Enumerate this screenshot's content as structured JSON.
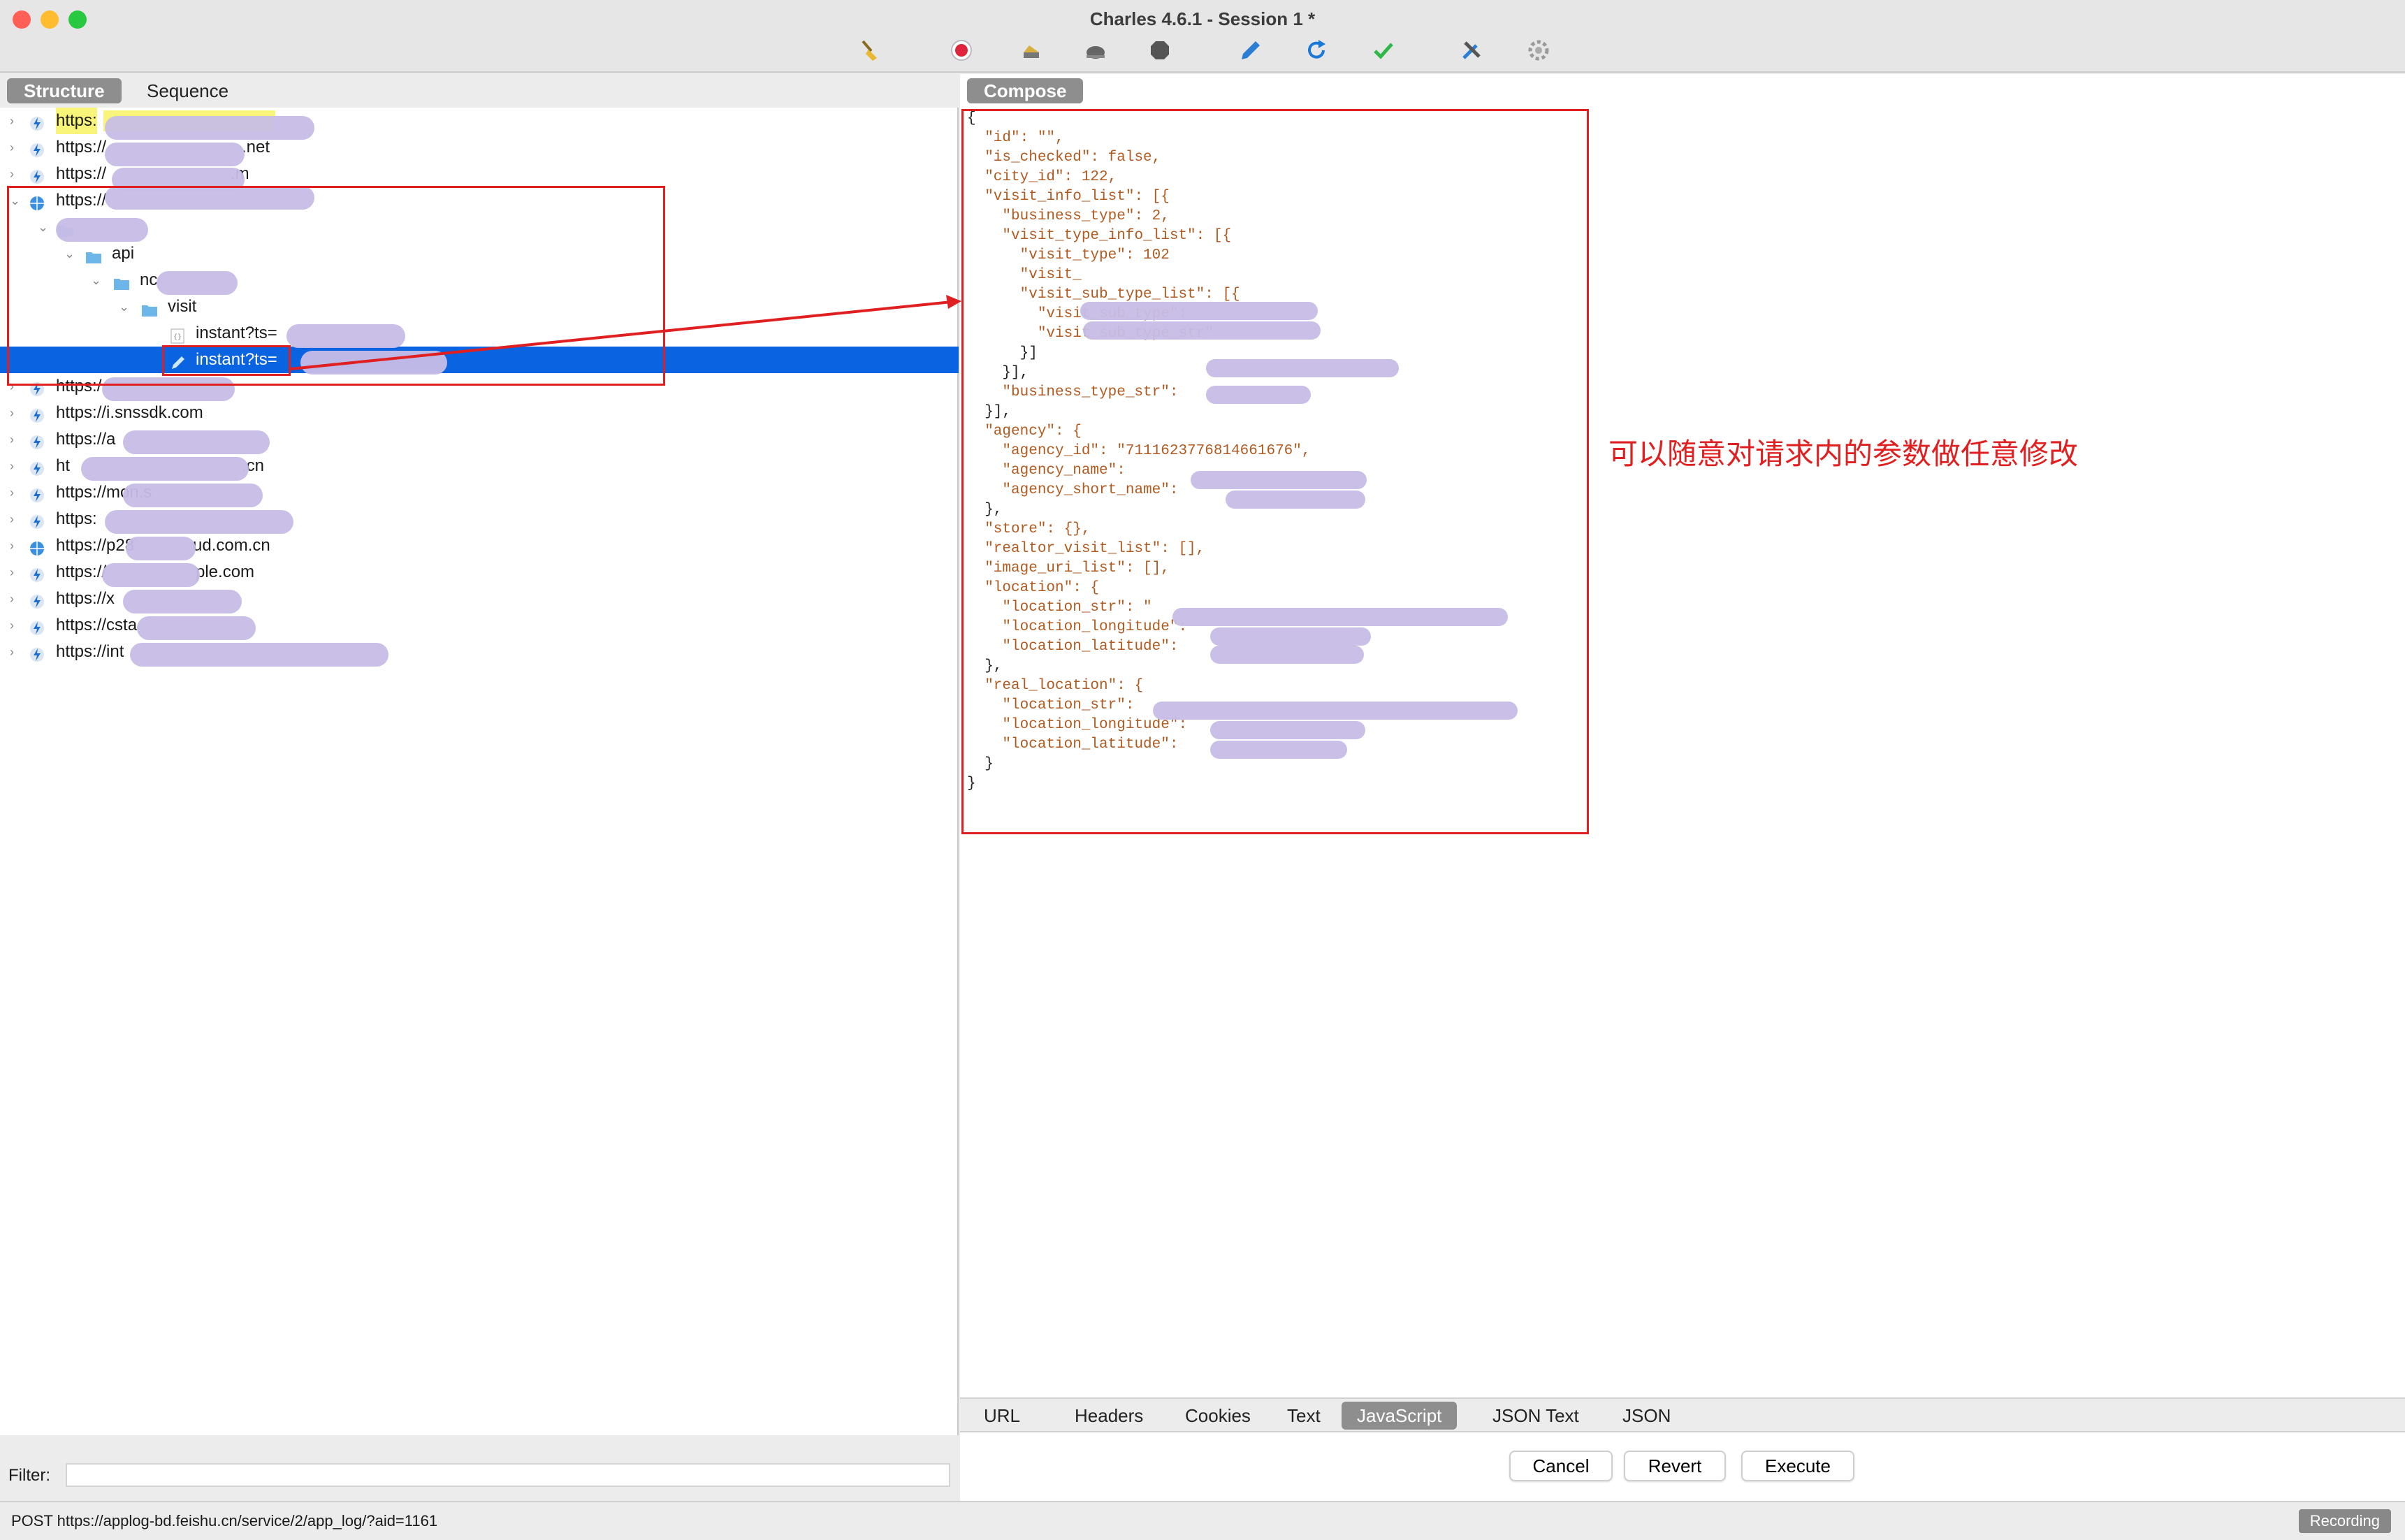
{
  "window": {
    "title": "Charles 4.6.1 - Session 1 *"
  },
  "toolbar": {
    "icons": [
      "broom-icon",
      "record-icon",
      "throttle-icon",
      "turtle-icon",
      "stop-icon",
      "pen-icon",
      "refresh-icon",
      "check-icon",
      "tools-icon",
      "settings-icon"
    ]
  },
  "left_tabs": {
    "structure": "Structure",
    "sequence": "Sequence"
  },
  "tree": {
    "rows": [
      {
        "label": "https:",
        "icon": "lightning-icon"
      },
      {
        "label": "https://",
        "suffix": ".net",
        "icon": "lightning-icon"
      },
      {
        "label": "https://",
        "suffix": ".m",
        "icon": "lightning-icon"
      },
      {
        "label": "https://",
        "icon": "globe-icon"
      },
      {
        "label": "",
        "icon": "folder-icon"
      },
      {
        "label": "api",
        "icon": "folder-icon"
      },
      {
        "label": "nc",
        "icon": "folder-icon"
      },
      {
        "label": "visit",
        "icon": "folder-icon"
      },
      {
        "label": "instant?ts=",
        "icon": "json-file-icon"
      },
      {
        "label": "instant?ts=",
        "icon": "edit-icon"
      },
      {
        "label": "https:/",
        "icon": "lightning-icon"
      },
      {
        "label": "https://i.snssdk.com",
        "icon": "lightning-icon"
      },
      {
        "label": "https://a",
        "icon": "lightning-icon"
      },
      {
        "label": "ht",
        "suffix": ".cn",
        "icon": "lightning-icon"
      },
      {
        "label": "https://mon.s",
        "icon": "lightning-icon"
      },
      {
        "label": "https:",
        "icon": "lightning-icon"
      },
      {
        "label": "https://p28",
        "suffix": "ud.com.cn",
        "icon": "globe-icon"
      },
      {
        "label": "https://",
        "suffix": "ple.com",
        "icon": "lightning-icon"
      },
      {
        "label": "https://x",
        "icon": "lightning-icon"
      },
      {
        "label": "https://csta",
        "icon": "lightning-icon"
      },
      {
        "label": "https://int",
        "icon": "lightning-icon"
      }
    ]
  },
  "filter": {
    "label": "Filter:",
    "value": ""
  },
  "status": {
    "text": "POST https://applog-bd.feishu.cn/service/2/app_log/?aid=1161",
    "recording": "Recording"
  },
  "compose": {
    "tab": "Compose",
    "code_lines": [
      "{",
      "  \"id\": \"\",",
      "  \"is_checked\": false,",
      "  \"city_id\": 122,",
      "  \"visit_info_list\": [{",
      "    \"business_type\": 2,",
      "    \"visit_type_info_list\": [{",
      "      \"visit_type\": 102",
      "      \"visit_",
      "      \"visit_sub_type_list\": [{",
      "        \"visit_sub_type\":",
      "        \"visit_sub_type_str\"",
      "      }]",
      "    }],",
      "    \"business_type_str\":",
      "  }],",
      "  \"agency\": {",
      "    \"agency_id\": \"7111623776814661676\",",
      "    \"agency_name\":",
      "    \"agency_short_name\":",
      "  },",
      "  \"store\": {},",
      "  \"realtor_visit_list\": [],",
      "  \"image_uri_list\": [],",
      "  \"location\": {",
      "    \"location_str\": \"",
      "    \"location_longitude\":",
      "    \"location_latitude\":",
      "  },",
      "  \"real_location\": {",
      "    \"location_str\":",
      "    \"location_longitude\":",
      "    \"location_latitude\":",
      "  }",
      "}"
    ]
  },
  "bottom_tabs": [
    "URL",
    "Headers",
    "Cookies",
    "Text",
    "JavaScript",
    "JSON Text",
    "JSON"
  ],
  "bottom_tabs_active": "JavaScript",
  "actions": {
    "cancel": "Cancel",
    "revert": "Revert",
    "execute": "Execute"
  },
  "annotation": {
    "text": "可以随意对请求内的参数做任意修改",
    "color": "#e02020"
  }
}
